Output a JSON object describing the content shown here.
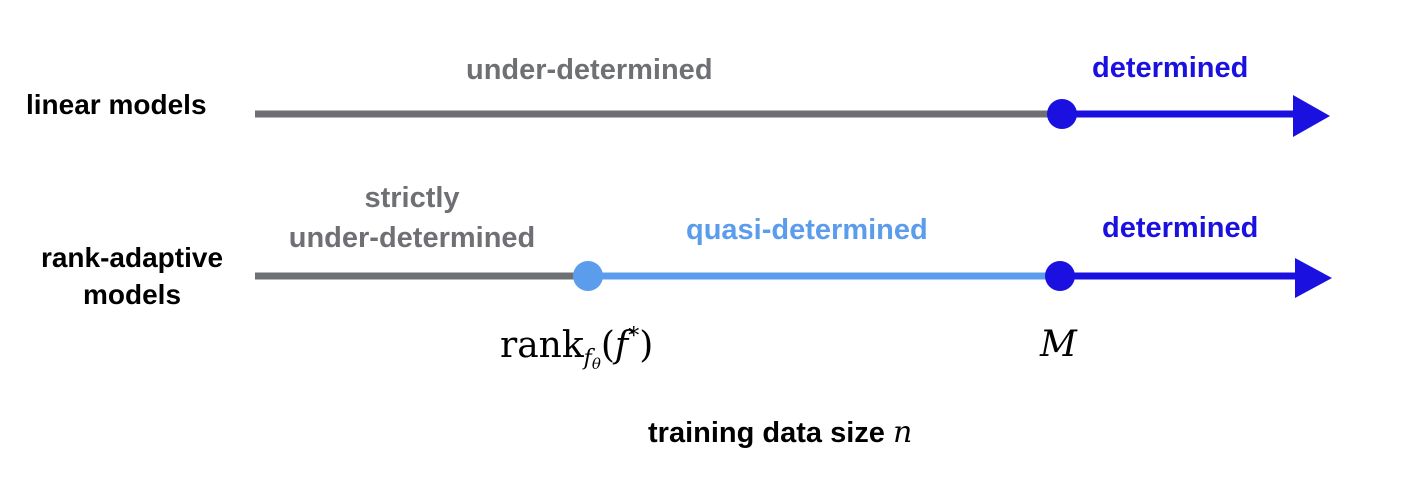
{
  "colors": {
    "gray": "#6e7074",
    "light_blue": "#5b9cec",
    "dark_blue": "#1a10e0",
    "text": "#000000"
  },
  "rows": [
    {
      "label": "linear models",
      "regimes": [
        {
          "text": "under-determined",
          "color": "#6e7074"
        },
        {
          "text": "determined",
          "color": "#1a10e0"
        }
      ]
    },
    {
      "label_lines": [
        "rank-adaptive",
        "models"
      ],
      "regimes": [
        {
          "text_lines": [
            "strictly",
            "under-determined"
          ],
          "color": "#6e7074"
        },
        {
          "text": "quasi-determined",
          "color": "#5b9cec"
        },
        {
          "text": "determined",
          "color": "#1a10e0"
        }
      ]
    }
  ],
  "markers": {
    "rank": {
      "base": "rank",
      "sub": "f",
      "subsub": "θ",
      "open": "(",
      "arg": "f",
      "sup": "*",
      "close": ")"
    },
    "M": "M"
  },
  "axis": {
    "label": "training data size",
    "var": "n"
  }
}
